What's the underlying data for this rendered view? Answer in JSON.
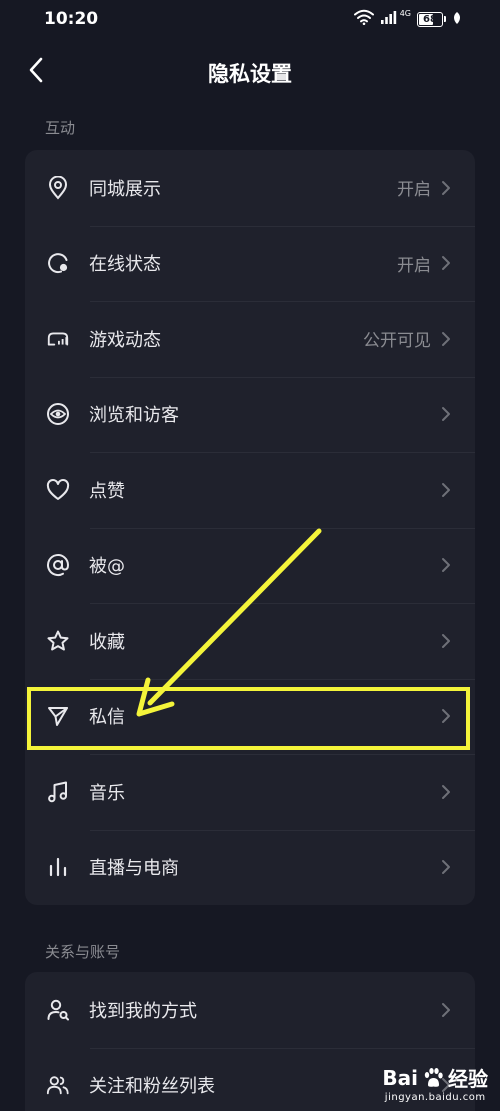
{
  "status_bar": {
    "time": "10:20",
    "network": "4G",
    "battery": "68",
    "battery_level": 0.68
  },
  "header": {
    "title": "隐私设置"
  },
  "sections": [
    {
      "title": "互动",
      "items": [
        {
          "label": "同城展示",
          "value": "开启",
          "icon": "location-pin-icon"
        },
        {
          "label": "在线状态",
          "value": "开启",
          "icon": "online-status-icon"
        },
        {
          "label": "游戏动态",
          "value": "公开可见",
          "icon": "game-controller-icon"
        },
        {
          "label": "浏览和访客",
          "value": "",
          "icon": "eye-icon"
        },
        {
          "label": "点赞",
          "value": "",
          "icon": "heart-icon"
        },
        {
          "label": "被@",
          "value": "",
          "icon": "at-sign-icon"
        },
        {
          "label": "收藏",
          "value": "",
          "icon": "star-icon"
        },
        {
          "label": "私信",
          "value": "",
          "icon": "send-icon"
        },
        {
          "label": "音乐",
          "value": "",
          "icon": "music-note-icon"
        },
        {
          "label": "直播与电商",
          "value": "",
          "icon": "live-bars-icon"
        }
      ]
    },
    {
      "title": "关系与账号",
      "items": [
        {
          "label": "找到我的方式",
          "value": "",
          "icon": "find-user-icon"
        },
        {
          "label": "关注和粉丝列表",
          "value": "",
          "icon": "followers-icon"
        }
      ]
    }
  ],
  "annotation": {
    "highlight_color": "#f4f43a"
  },
  "watermark": {
    "brand": "Bai",
    "brand_suffix": "经验",
    "url": "jingyan.baidu.com"
  },
  "colors": {
    "background": "#161823",
    "card": "#1f212c",
    "text": "#e8e8ec",
    "muted": "#8a8b91"
  }
}
